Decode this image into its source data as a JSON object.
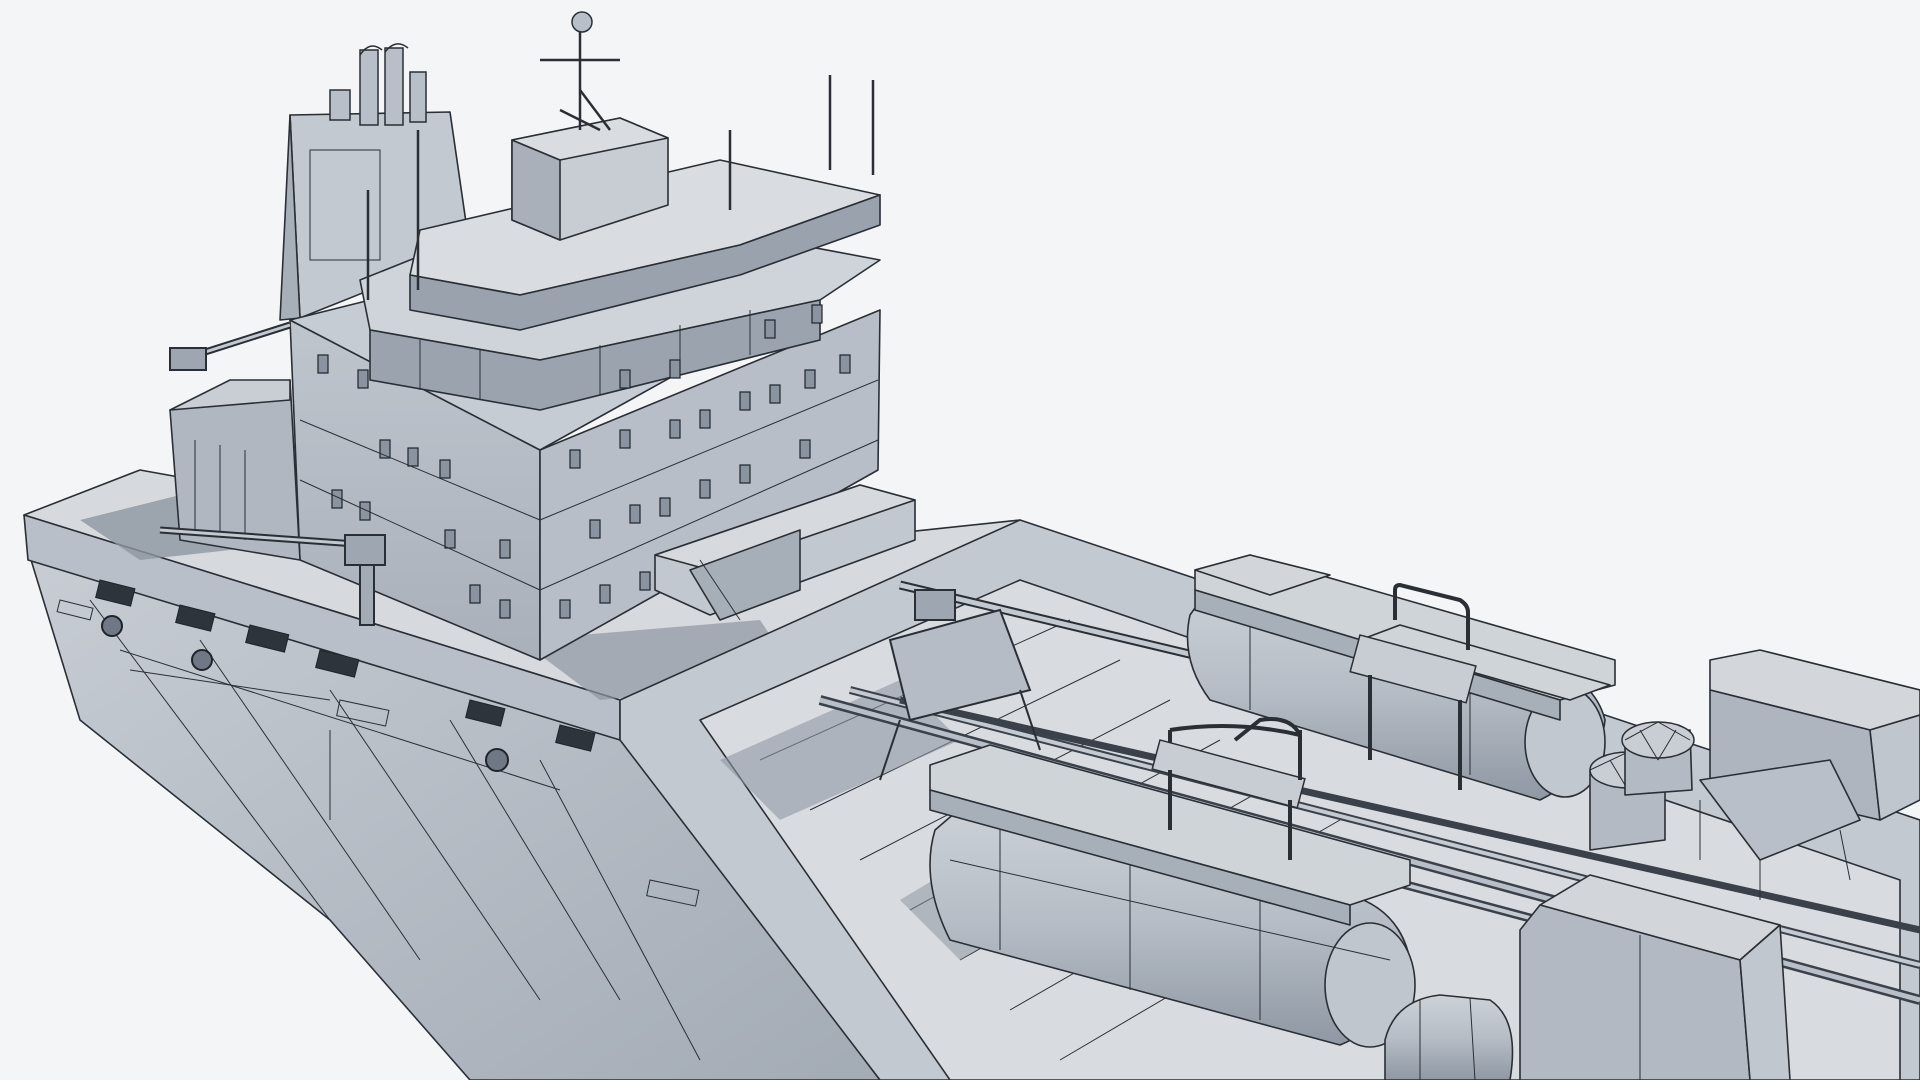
{
  "scene": {
    "subject": "ship-3d-wireframe-render",
    "background_color": "#f4f5f6",
    "colors": {
      "hull_light": "#c7ccd3",
      "hull_mid": "#aeb5be",
      "hull_dark": "#8e97a2",
      "deck": "#d5d9de",
      "shadow": "#6f7884",
      "wire": "#2a2f36"
    }
  }
}
